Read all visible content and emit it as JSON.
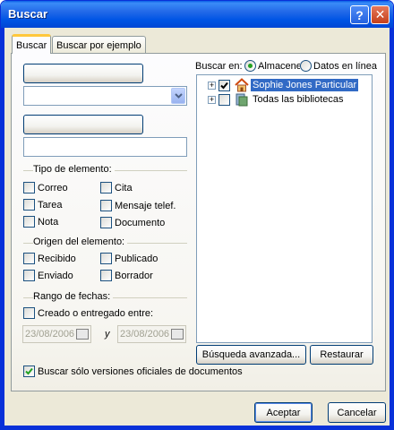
{
  "window": {
    "title": "Buscar"
  },
  "tabs": [
    {
      "label": "Buscar",
      "active": true
    },
    {
      "label": "Buscar por ejemplo",
      "active": false
    }
  ],
  "left": {
    "field1_button": "",
    "field1_combo_value": "",
    "field2_button": "",
    "field2_value": "",
    "tipo_label": "Tipo de elemento:",
    "tipo_items": [
      {
        "label": "Correo",
        "checked": false
      },
      {
        "label": "Cita",
        "checked": false
      },
      {
        "label": "Tarea",
        "checked": false
      },
      {
        "label": "Mensaje telef.",
        "checked": false
      },
      {
        "label": "Nota",
        "checked": false
      },
      {
        "label": "Documento",
        "checked": false
      }
    ],
    "origen_label": "Origen del elemento:",
    "origen_items": [
      {
        "label": "Recibido",
        "checked": false
      },
      {
        "label": "Publicado",
        "checked": false
      },
      {
        "label": "Enviado",
        "checked": false
      },
      {
        "label": "Borrador",
        "checked": false
      }
    ],
    "rango_label": "Rango de fechas:",
    "creado_label": "Creado o entregado entre:",
    "date_from": "23/08/2006",
    "date_and": "y",
    "date_to": "23/08/2006",
    "official_label": "Buscar sólo versiones oficiales de documentos"
  },
  "right": {
    "buscar_en_label": "Buscar en:",
    "radio_almacen": "Almacenes",
    "radio_online": "Datos en línea",
    "tree": [
      {
        "label": "Sophie Jones Particular",
        "checked": true,
        "selected": true,
        "icon": "house-icon"
      },
      {
        "label": "Todas las bibliotecas",
        "checked": false,
        "selected": false,
        "icon": "library-icon"
      }
    ],
    "advanced_button": "Búsqueda avanzada...",
    "restore_button": "Restaurar"
  },
  "footer": {
    "accept_button": "Aceptar",
    "cancel_button": "Cancelar"
  }
}
